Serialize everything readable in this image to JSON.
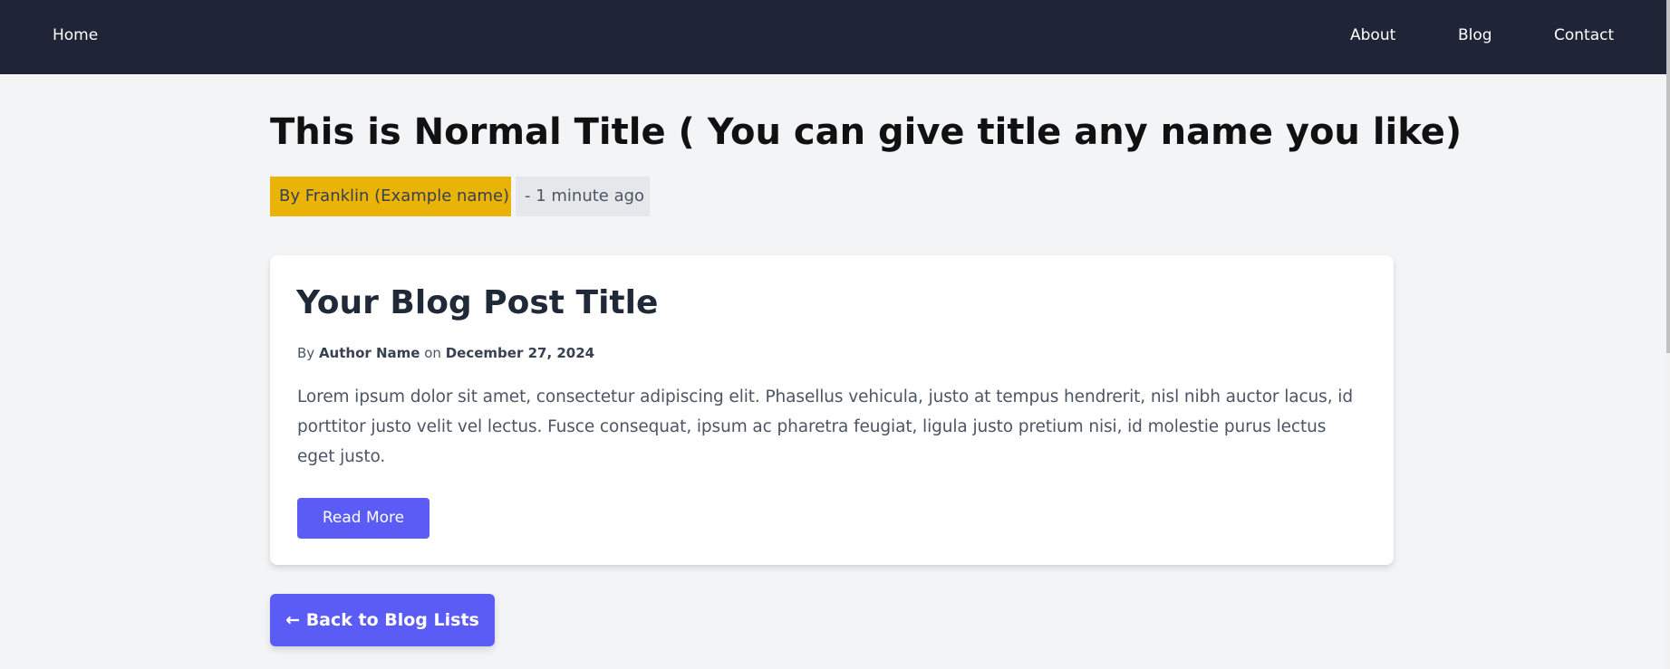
{
  "nav": {
    "home": "Home",
    "about": "About",
    "blog": "Blog",
    "contact": "Contact"
  },
  "page": {
    "title": "This is Normal Title ( You can give title any name you like)",
    "author_badge": "By Franklin (Example name)",
    "time_badge": "- 1 minute ago"
  },
  "post": {
    "title": "Your Blog Post Title",
    "by_prefix": "By ",
    "author": "Author Name",
    "on_text": " on ",
    "date": "December 27, 2024",
    "excerpt": "Lorem ipsum dolor sit amet, consectetur adipiscing elit. Phasellus vehicula, justo at tempus hendrerit, nisl nibh auctor lacus, id porttitor justo velit vel lectus. Fusce consequat, ipsum ac pharetra feugiat, ligula justo pretium nisi, id molestie purus lectus eget justo.",
    "read_more_label": "Read More"
  },
  "back_button_label": "← Back to Blog Lists",
  "colors": {
    "navbar": "#1f2437",
    "accent": "#5b5cf6",
    "author_badge": "#eab308",
    "time_badge": "#e5e7eb",
    "page_background": "#f3f4f6"
  }
}
